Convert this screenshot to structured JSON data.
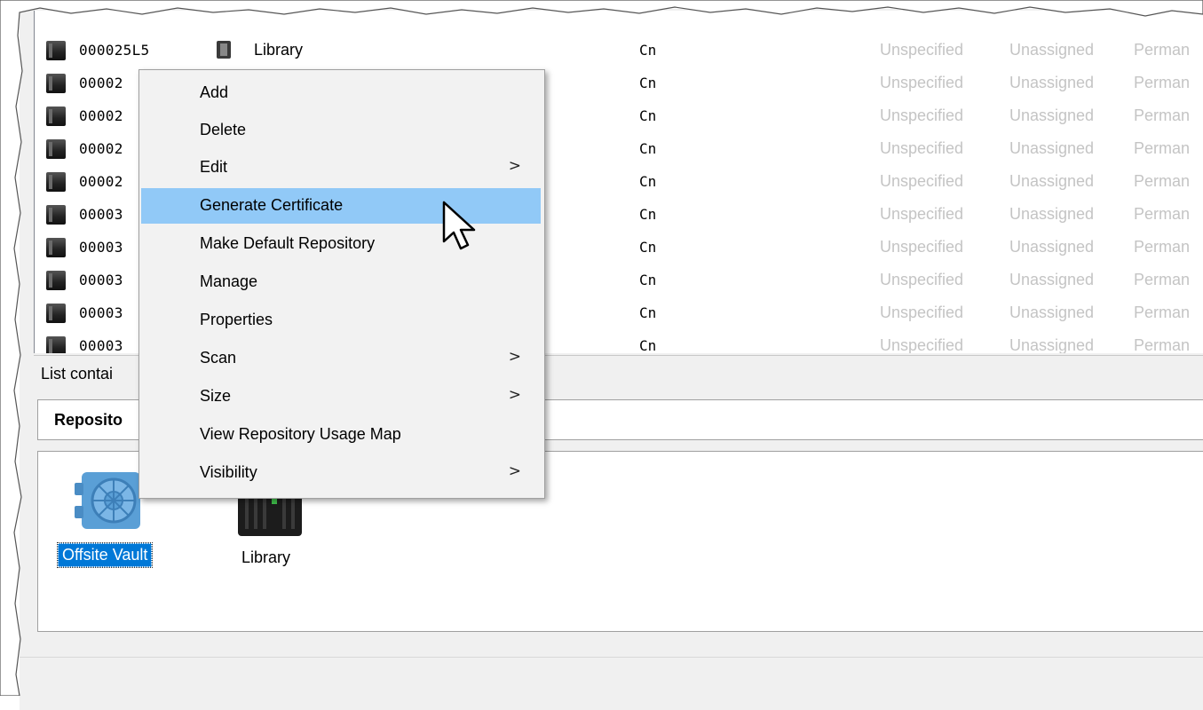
{
  "list": {
    "rows": [
      {
        "id": "000025L5",
        "library": "Library",
        "media": "Cn",
        "col1": "Unspecified",
        "col2": "Unassigned",
        "col3": "Perman"
      },
      {
        "id": "00002",
        "library": "",
        "media": "Cn",
        "col1": "Unspecified",
        "col2": "Unassigned",
        "col3": "Perman"
      },
      {
        "id": "00002",
        "library": "",
        "media": "Cn",
        "col1": "Unspecified",
        "col2": "Unassigned",
        "col3": "Perman"
      },
      {
        "id": "00002",
        "library": "",
        "media": "Cn",
        "col1": "Unspecified",
        "col2": "Unassigned",
        "col3": "Perman"
      },
      {
        "id": "00002",
        "library": "",
        "media": "Cn",
        "col1": "Unspecified",
        "col2": "Unassigned",
        "col3": "Perman"
      },
      {
        "id": "00003",
        "library": "",
        "media": "Cn",
        "col1": "Unspecified",
        "col2": "Unassigned",
        "col3": "Perman"
      },
      {
        "id": "00003",
        "library": "",
        "media": "Cn",
        "col1": "Unspecified",
        "col2": "Unassigned",
        "col3": "Perman"
      },
      {
        "id": "00003",
        "library": "",
        "media": "Cn",
        "col1": "Unspecified",
        "col2": "Unassigned",
        "col3": "Perman"
      },
      {
        "id": "00003",
        "library": "",
        "media": "Cn",
        "col1": "Unspecified",
        "col2": "Unassigned",
        "col3": "Perman"
      },
      {
        "id": "00003",
        "library": "",
        "media": "Cn",
        "col1": "Unspecified",
        "col2": "Unassigned",
        "col3": "Perman"
      }
    ]
  },
  "status_bar": {
    "text": "List contai"
  },
  "repositories": {
    "header": "Reposito",
    "items": [
      {
        "label": "Offsite Vault",
        "selected": true,
        "icon": "vault-icon"
      },
      {
        "label": "Library",
        "selected": false,
        "icon": "library-icon"
      }
    ]
  },
  "context_menu": {
    "items": [
      {
        "label": "Add",
        "submenu": false
      },
      {
        "label": "Delete",
        "submenu": false
      },
      {
        "label": "Edit",
        "submenu": true
      },
      {
        "label": "Generate Certificate",
        "submenu": false,
        "highlighted": true
      },
      {
        "label": "Make Default Repository",
        "submenu": false
      },
      {
        "label": "Manage",
        "submenu": false
      },
      {
        "label": "Properties",
        "submenu": false
      },
      {
        "label": "Scan",
        "submenu": true
      },
      {
        "label": "Size",
        "submenu": true
      },
      {
        "label": "View Repository Usage Map",
        "submenu": false
      },
      {
        "label": "Visibility",
        "submenu": true
      }
    ],
    "submenu_arrow": ">"
  },
  "colors": {
    "highlight": "#91c9f7",
    "selection": "#0078d7",
    "disabled_text": "#c4c4c4"
  }
}
